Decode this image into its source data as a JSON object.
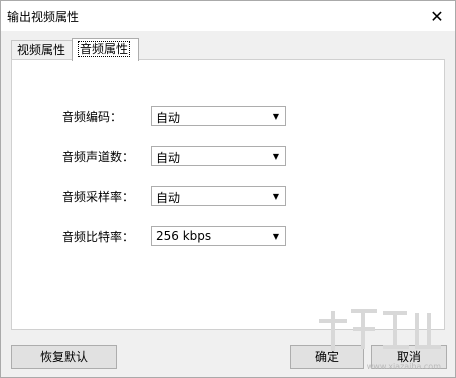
{
  "window": {
    "title": "输出视频属性",
    "close_glyph": "✕"
  },
  "tabs": [
    {
      "label": "视频属性",
      "active": false
    },
    {
      "label": "音频属性",
      "active": true
    }
  ],
  "fields": [
    {
      "label": "音频编码：",
      "value": "自动"
    },
    {
      "label": "音频声道数：",
      "value": "自动"
    },
    {
      "label": "音频采样率：",
      "value": "自动"
    },
    {
      "label": "音频比特率：",
      "value": "256 kbps"
    }
  ],
  "dropdown_arrow": "▼",
  "buttons": {
    "reset": "恢复默认",
    "ok": "确定",
    "cancel": "取消"
  },
  "watermark": {
    "site": "www.xiazaiba.com"
  }
}
